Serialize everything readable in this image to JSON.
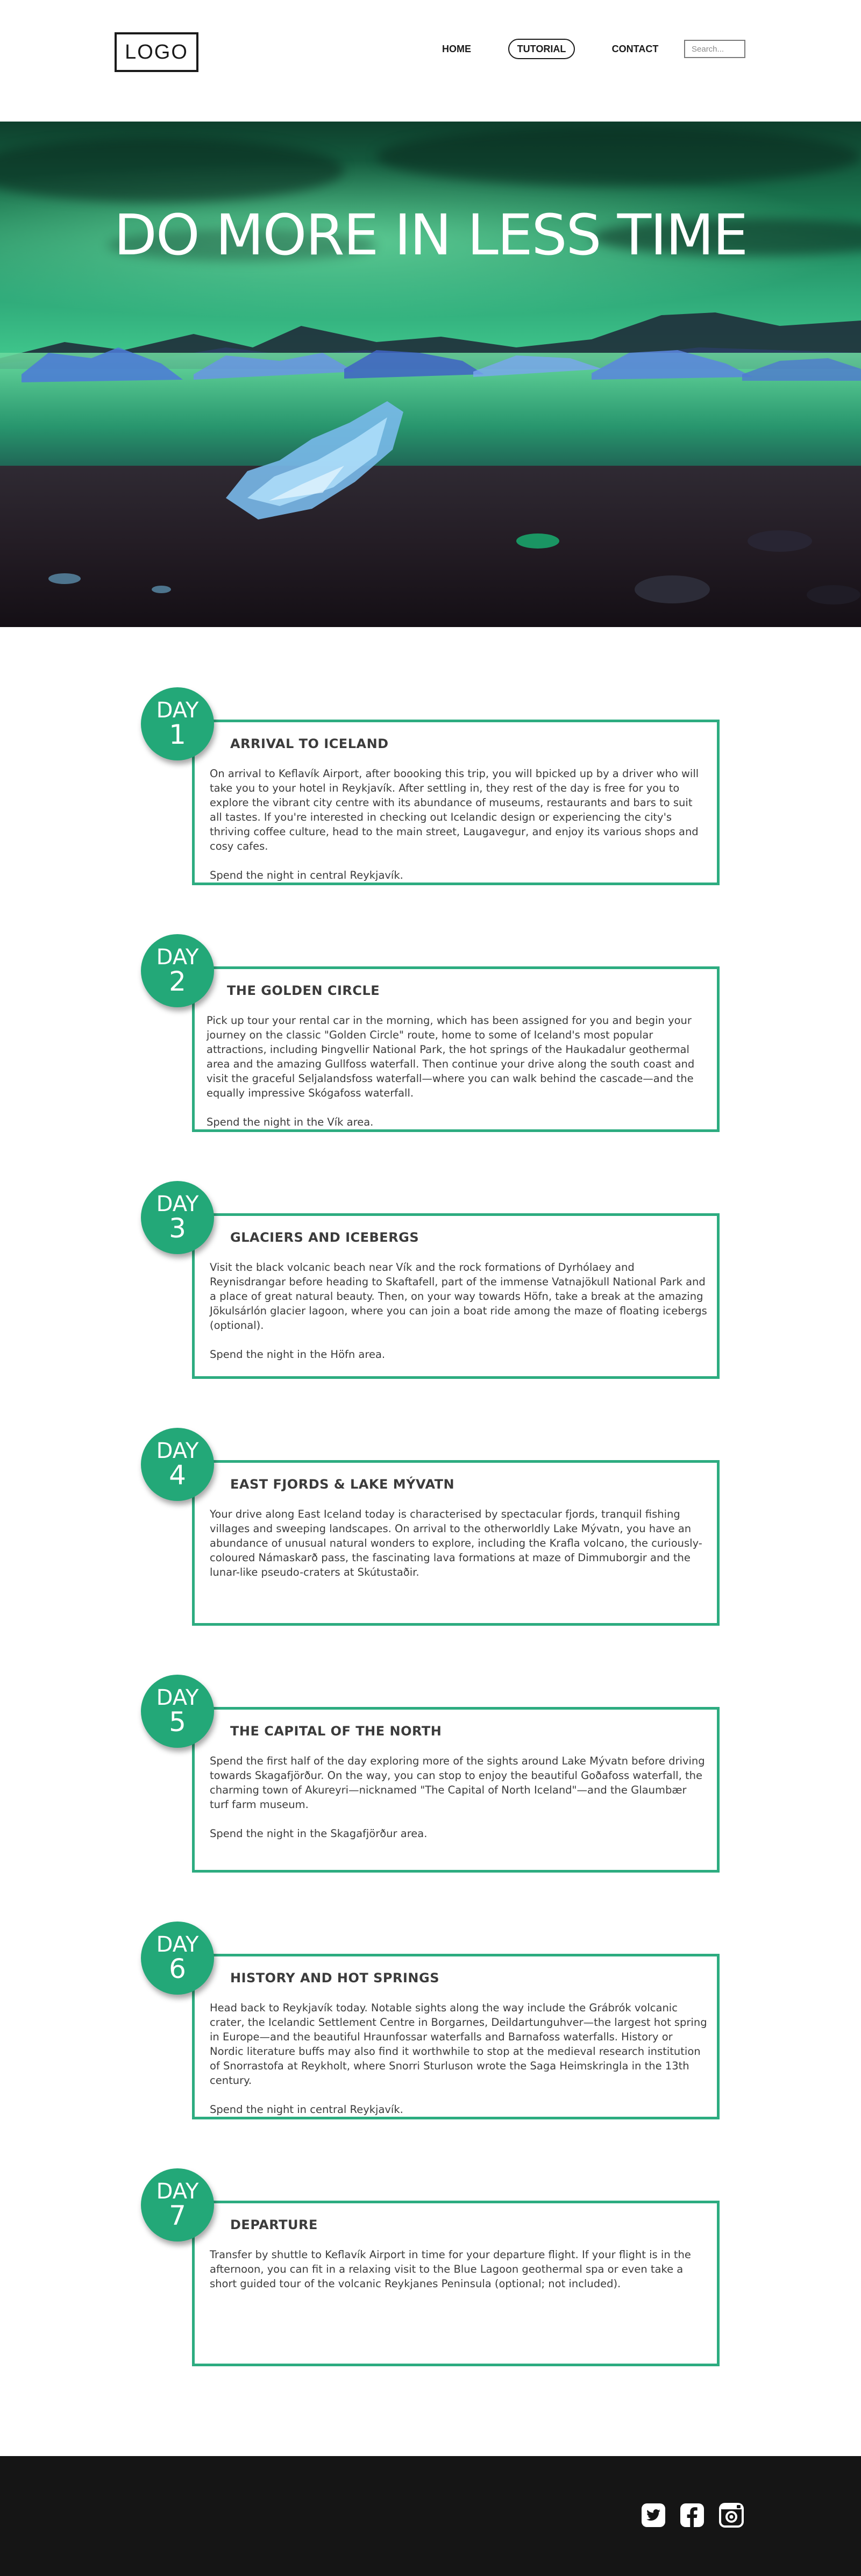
{
  "header": {
    "logo": "LOGO",
    "nav": {
      "home": "HOME",
      "tutorial": "TUTORIAL",
      "contact": "CONTACT"
    },
    "search_placeholder": "Search..."
  },
  "hero": {
    "title": "DO MORE IN LESS TIME"
  },
  "days": [
    {
      "label": "DAY",
      "number": "1",
      "title": "ARRIVAL TO ICELAND",
      "body": "On arrival to Keflavík Airport, after boooking this trip, you will bpicked up by a driver who will take you to your hotel in Reykjavík. After settling in, they rest of the day is free for you to explore the vibrant city centre with its abundance of museums, restaurants and bars to suit all tastes. If you're interested in checking out Icelandic design or experiencing the city's thriving coffee culture, head to the main street, Laugavegur, and enjoy its various shops and cosy cafes.",
      "note": "Spend the night in central Reykjavík."
    },
    {
      "label": "DAY",
      "number": "2",
      "title": "THE GOLDEN CIRCLE",
      "body": "Pick up tour your rental car in the morning, which has been assigned for you and begin your journey on the classic \"Golden Circle\" route, home to some of Iceland's most popular attractions, including Þingvellir National Park, the hot springs of the Haukadalur geothermal area and the amazing Gullfoss waterfall. Then continue your drive along the south coast and visit the graceful Seljalandsfoss waterfall—where you can walk behind the cascade—and the equally impressive Skógafoss waterfall.",
      "note": "Spend the night in the Vík area."
    },
    {
      "label": "DAY",
      "number": "3",
      "title": "GLACIERS AND ICEBERGS",
      "body": "Visit the black volcanic beach near Vík and the rock formations of Dyrhólaey and Reynisdrangar before heading to Skaftafell, part of the immense Vatnajökull National Park and a place of great natural beauty. Then, on your way towards Höfn, take a break at the amazing Jökulsárlón glacier lagoon, where you can join a boat ride among the maze of floating icebergs (optional).",
      "note": "Spend the night in the Höfn area."
    },
    {
      "label": "DAY",
      "number": "4",
      "title": "EAST FJORDS & LAKE MÝVATN",
      "body": "Your drive along East Iceland today is characterised by spectacular fjords, tranquil fishing villages and sweeping landscapes. On arrival to the otherworldly Lake Mývatn, you have an abundance of unusual natural wonders to explore, including the Krafla volcano, the curiously-coloured Námaskarð pass, the fascinating lava formations at maze of Dimmuborgir and the lunar-like pseudo-craters at Skútustaðir.",
      "note": ""
    },
    {
      "label": "DAY",
      "number": "5",
      "title": "THE CAPITAL OF THE NORTH",
      "body": "Spend the first half of the day exploring more of the sights around Lake Mývatn before driving towards Skagafjörður. On the way, you can stop to enjoy the beautiful Goðafoss waterfall, the charming town of Akureyri—nicknamed \"The Capital of North Iceland\"—and the Glaumbær turf farm museum.",
      "note": "Spend the night in the Skagafjörður area."
    },
    {
      "label": "DAY",
      "number": "6",
      "title": "HISTORY AND HOT SPRINGS",
      "body": "Head back to Reykjavík today. Notable sights along the way include the Grábrók volcanic crater, the Icelandic Settlement Centre in Borgarnes, Deildartunguhver—the largest hot spring in Europe—and the beautiful Hraunfossar waterfalls and Barnafoss waterfalls. History or Nordic literature buffs may also find it worthwhile to stop at the medieval research institution of Snorrastofa at Reykholt, where Snorri Sturluson wrote the Saga Heimskringla in the 13th century.",
      "note": "Spend the night in central Reykjavík."
    },
    {
      "label": "DAY",
      "number": "7",
      "title": "DEPARTURE",
      "body": "Transfer by shuttle to Keflavík Airport in time for your departure flight. If your flight is in the afternoon, you can fit in a relaxing visit to the Blue Lagoon geothermal spa or even take a short guided tour of the volcanic Reykjanes Peninsula (optional; not included).",
      "note": ""
    }
  ],
  "footer": {
    "social": [
      "twitter-icon",
      "facebook-icon",
      "instagram-icon"
    ]
  },
  "colors": {
    "accent": "#23a878",
    "card_border": "#2dac80",
    "footer_bg": "#151515"
  }
}
